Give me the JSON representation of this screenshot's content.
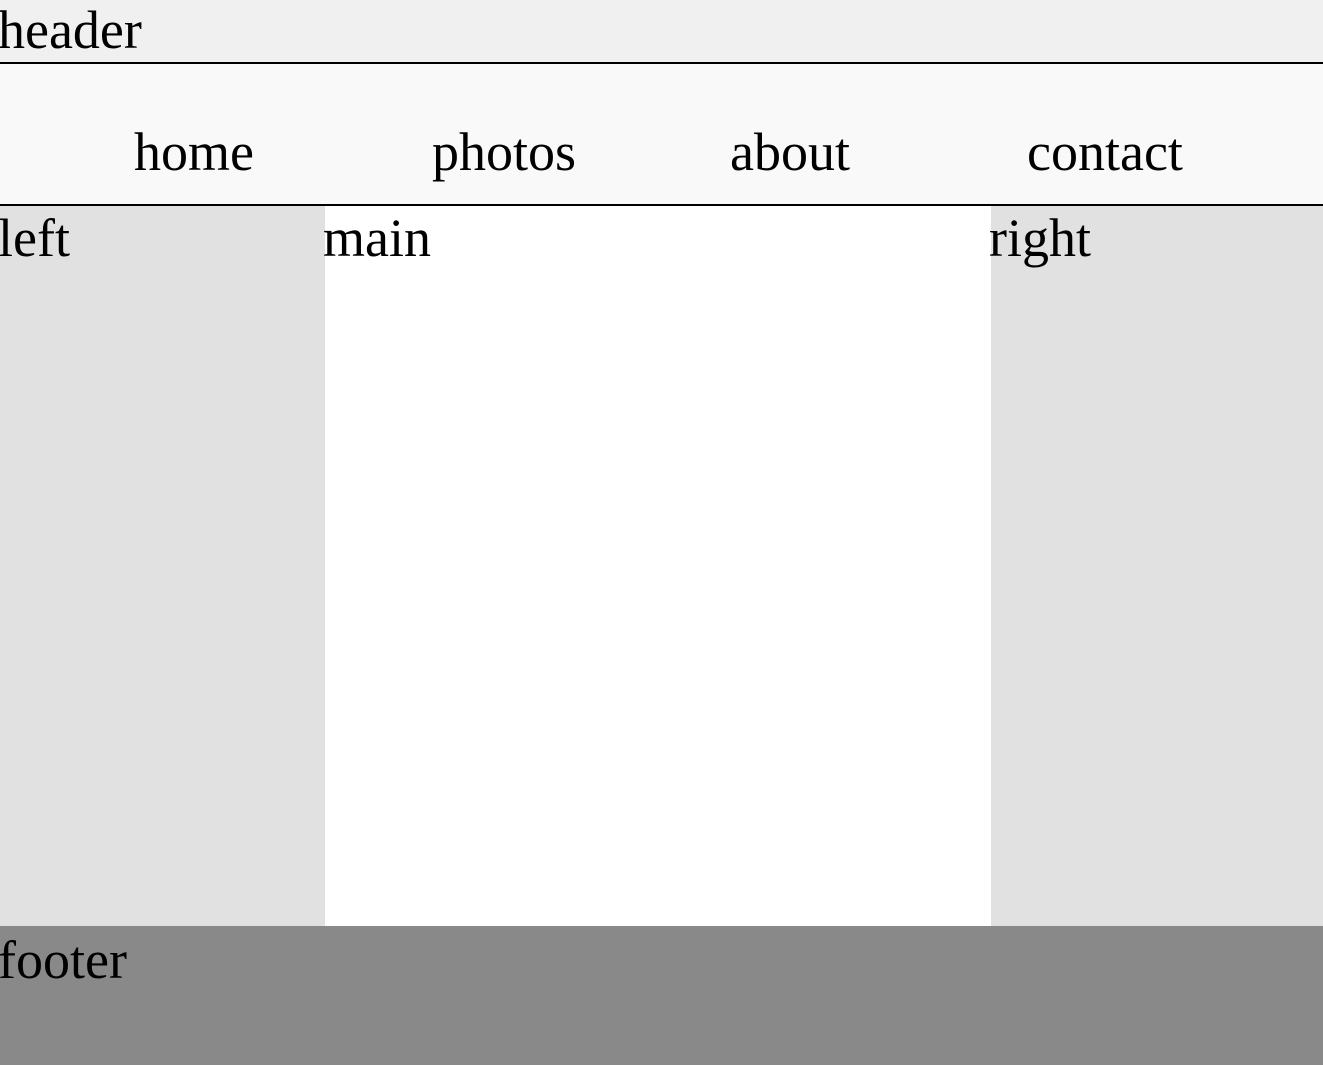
{
  "header": {
    "title": "header"
  },
  "nav": {
    "items": [
      {
        "label": "home"
      },
      {
        "label": "photos"
      },
      {
        "label": "about"
      },
      {
        "label": "contact"
      }
    ]
  },
  "columns": {
    "left": "left",
    "main": "main",
    "right": "right"
  },
  "footer": {
    "label": "footer"
  },
  "colors": {
    "header_bg": "#f0f0f0",
    "nav_bg": "#f9f9f9",
    "side_bg": "#e1e1e1",
    "main_bg": "#ffffff",
    "footer_bg": "#898989"
  }
}
